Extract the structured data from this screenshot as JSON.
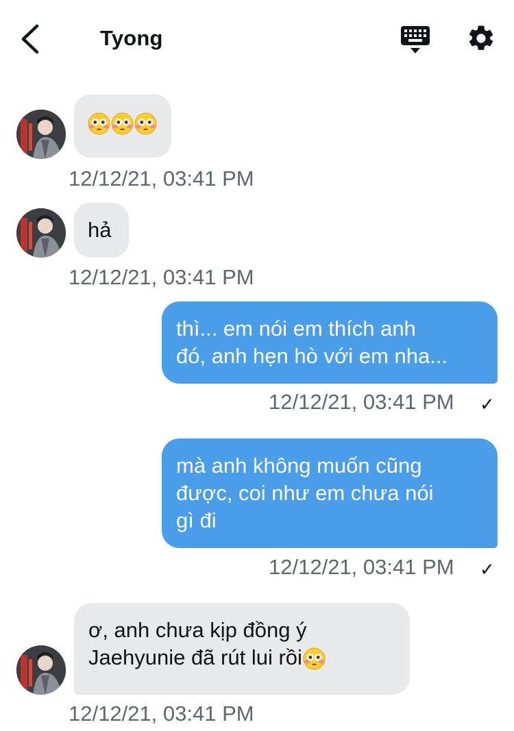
{
  "header": {
    "title": "Tyong"
  },
  "messages": [
    {
      "direction": "incoming",
      "text": "",
      "emoji_count": 3,
      "emoji": "flushed-face",
      "timestamp": "12/12/21, 03:41 PM"
    },
    {
      "direction": "incoming",
      "text": "hả",
      "timestamp": "12/12/21, 03:41 PM"
    },
    {
      "direction": "outgoing",
      "lines": [
        "thì... em nói em thích anh",
        "đó, anh hẹn hò với em nha..."
      ],
      "timestamp": "12/12/21, 03:41 PM",
      "read": "✓"
    },
    {
      "direction": "outgoing",
      "lines": [
        "mà anh không muốn cũng",
        "được, coi như em chưa nói",
        "gì đi"
      ],
      "timestamp": "12/12/21, 03:41 PM",
      "read": "✓"
    },
    {
      "direction": "incoming",
      "lines": [
        "ơ, anh chưa kịp đồng ý",
        "Jaehyunie đã rút lui rồi"
      ],
      "trailing_emoji": "flushed-face",
      "timestamp": "12/12/21, 03:41 PM"
    }
  ],
  "colors": {
    "incoming_bubble": "#e7e9eb",
    "outgoing_bubble": "#4a9de8",
    "timestamp": "#5b6670"
  }
}
